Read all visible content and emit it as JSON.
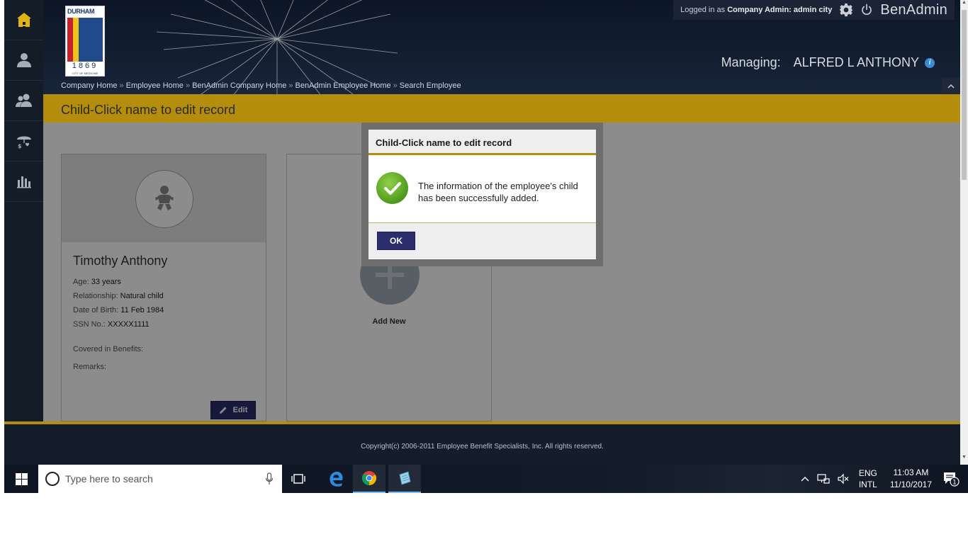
{
  "sidebar": {
    "items": [
      {
        "name": "home-icon"
      },
      {
        "name": "employee-icon"
      },
      {
        "name": "employees-icon"
      },
      {
        "name": "benefits-icon"
      },
      {
        "name": "reports-icon"
      }
    ]
  },
  "header": {
    "logo": {
      "top_text": "DURHAM",
      "year": "1869",
      "sub_text": "CITY OF MEDICINE"
    },
    "login": {
      "prefix": "Logged in as",
      "role": "Company Admin:",
      "user": "admin city"
    },
    "app_name": "BenAdmin",
    "managing_label": "Managing:",
    "managing_name": "ALFRED L ANTHONY",
    "breadcrumb": [
      "Company Home",
      "Employee Home",
      "BenAdmin Company Home",
      "BenAdmin Employee Home",
      "Search Employee"
    ],
    "breadcrumb_sep": "»"
  },
  "page": {
    "title": "Child-Click name to edit record"
  },
  "child_card": {
    "name": "Timothy Anthony",
    "age_label": "Age:",
    "age_value": "33 years",
    "relationship_label": "Relationship:",
    "relationship_value": "Natural child",
    "dob_label": "Date of Birth:",
    "dob_value": "11 Feb 1984",
    "ssn_label": "SSN No.:",
    "ssn_value": "XXXXX1111",
    "covered_label": "Covered in Benefits:",
    "remarks_label": "Remarks:",
    "edit_label": "Edit"
  },
  "add_card": {
    "label": "Add New"
  },
  "footer": {
    "copyright": "Copyright(c) 2006-2011 Employee Benefit Specialists, Inc. All rights reserved."
  },
  "modal": {
    "title": "Child-Click name to edit record",
    "message": "The information of the employee's child has been successfully added.",
    "ok_label": "OK"
  },
  "taskbar": {
    "search_placeholder": "Type here to search",
    "lang_top": "ENG",
    "lang_bottom": "INTL",
    "time": "11:03 AM",
    "date": "11/10/2017",
    "notification_count": "1"
  },
  "colors": {
    "accent_gold": "#b58d0c",
    "button_navy": "#2b2d6c",
    "sidebar_bg": "#141c28",
    "home_icon": "#e0b418"
  }
}
